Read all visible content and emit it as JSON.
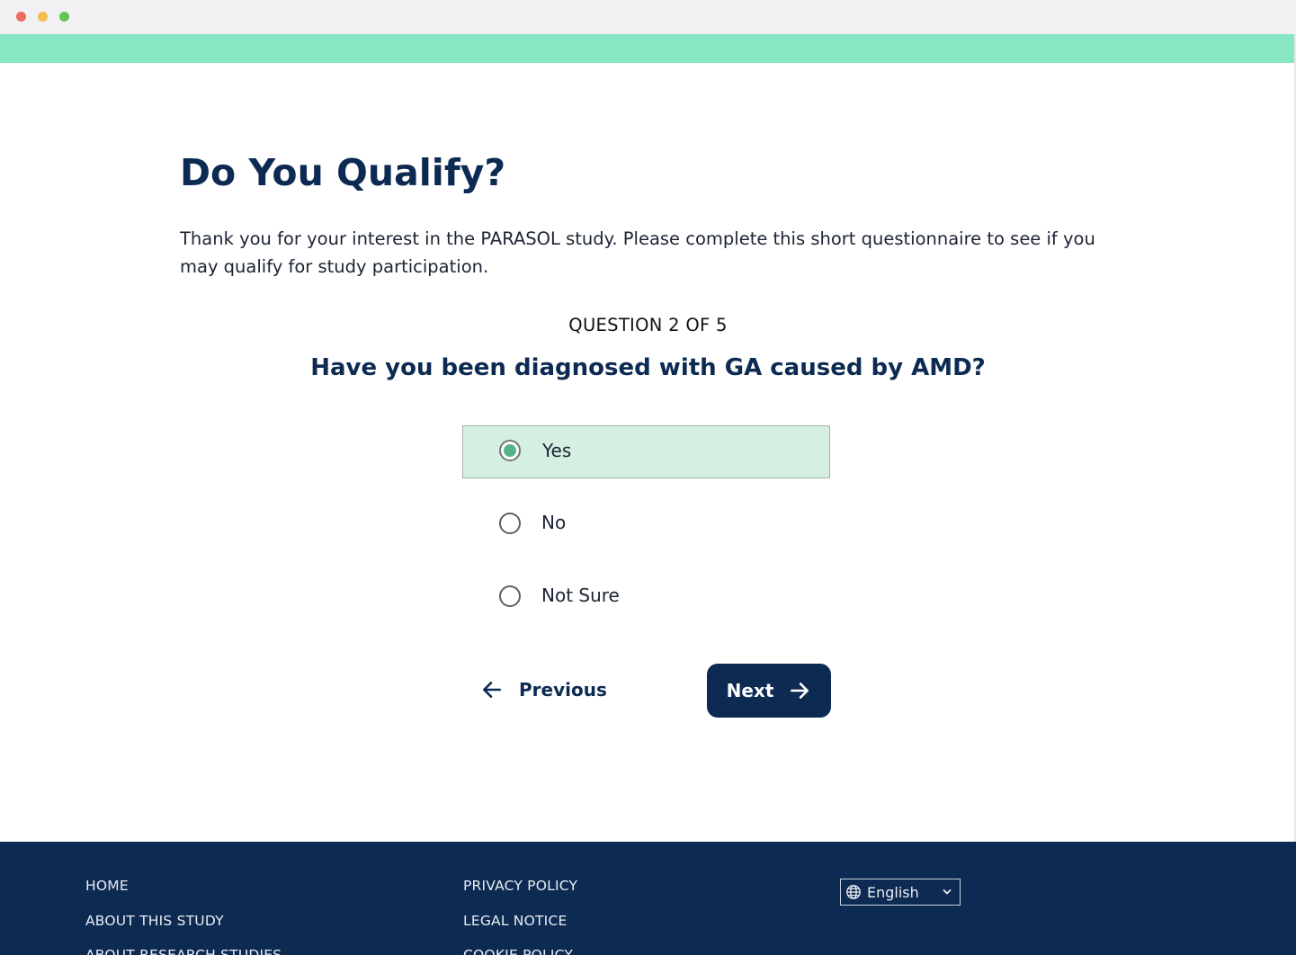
{
  "header": {
    "title": "Do You Qualify?",
    "intro": "Thank you for your interest in the PARASOL study. Please complete this short questionnaire to see if you may qualify for study participation."
  },
  "quiz": {
    "progress": "QUESTION 2 OF 5",
    "question": "Have you been diagnosed with GA caused by AMD?",
    "options": [
      {
        "label": "Yes",
        "selected": true
      },
      {
        "label": "No",
        "selected": false
      },
      {
        "label": "Not Sure",
        "selected": false
      }
    ],
    "previous_label": "Previous",
    "next_label": "Next"
  },
  "footer": {
    "column1": [
      "HOME",
      "ABOUT THIS STUDY",
      "ABOUT RESEARCH STUDIES"
    ],
    "column2": [
      "PRIVACY POLICY",
      "LEGAL NOTICE",
      "COOKIE POLICY"
    ],
    "language": "English"
  },
  "icons": {
    "previous": "arrow-left-icon",
    "next": "arrow-right-icon",
    "language": "globe-icon",
    "dropdown": "chevron-down-icon"
  },
  "colors": {
    "navy": "#0d2a52",
    "accent": "#86e7c2",
    "selected_bg": "#d6efe3",
    "radio_fill": "#55b485"
  }
}
